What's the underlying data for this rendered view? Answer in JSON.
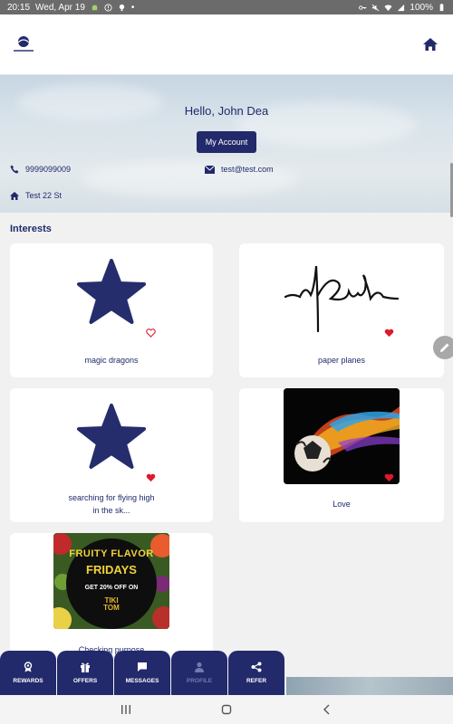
{
  "status_bar": {
    "time": "20:15",
    "date": "Wed, Apr 19",
    "battery": "100%"
  },
  "header": {
    "logo": "brand-logo",
    "home_icon": "home-icon"
  },
  "profile": {
    "greeting": "Hello, John Dea",
    "account_button": "My Account",
    "phone": "9999099009",
    "email": "test@test.com",
    "address": "Test 22 St"
  },
  "interests": {
    "title": "Interests",
    "items": [
      {
        "label": "magic dragons",
        "image": "star",
        "favorited": false
      },
      {
        "label": "paper planes",
        "image": "signature",
        "favorited": true
      },
      {
        "label": "searching for flying high in the sk...",
        "image": "star",
        "favorited": true
      },
      {
        "label": "Love",
        "image": "fire-football",
        "favorited": true
      },
      {
        "label": "Checking purpose",
        "image": "fruity-flavor-fridays",
        "favorited": false
      }
    ],
    "promo": {
      "line1": "FRUITY FLAVOR",
      "line2": "FRIDAYS",
      "line3": "GET 20% OFF ON",
      "brand1": "TIKI",
      "brand2": "TOM"
    }
  },
  "bottom_nav": {
    "tabs": [
      {
        "label": "REWARDS",
        "icon": "ribbon-icon",
        "active": false
      },
      {
        "label": "OFFERS",
        "icon": "gift-icon",
        "active": false
      },
      {
        "label": "MESSAGES",
        "icon": "chat-icon",
        "active": false
      },
      {
        "label": "PROFILE",
        "icon": "person-icon",
        "active": true
      },
      {
        "label": "REFER",
        "icon": "share-icon",
        "active": false
      }
    ]
  },
  "colors": {
    "primary": "#222a6b",
    "heart": "#e0192b",
    "background": "#f1f1f1"
  }
}
